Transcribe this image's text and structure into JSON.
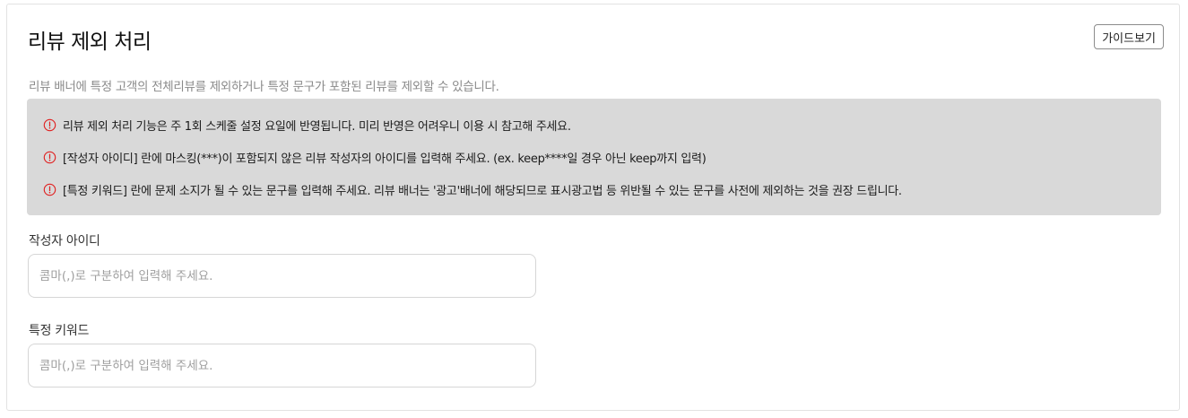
{
  "header": {
    "title": "리뷰 제외 처리",
    "guide_button": "가이드보기"
  },
  "description": "리뷰 배너에 특정 고객의 전체리뷰를 제외하거나 특정 문구가 포함된 리뷰를 제외할 수 있습니다.",
  "notices": [
    "리뷰 제외 처리 기능은 주 1회 스케줄 설정 요일에 반영됩니다. 미리 반영은 어려우니 이용 시 참고해 주세요.",
    "[작성자 아이디] 란에 마스킹(***)이 포함되지 않은 리뷰 작성자의 아이디를 입력해 주세요. (ex. keep****일 경우 아닌 keep까지 입력)",
    "[특정 키워드] 란에 문제 소지가 될 수 있는 문구를 입력해 주세요. 리뷰 배너는 '광고'배너에 해당되므로 표시광고법 등 위반될 수 있는 문구를 사전에 제외하는 것을 권장 드립니다."
  ],
  "fields": {
    "author_id": {
      "label": "작성자 아이디",
      "value": "",
      "placeholder": "콤마(,)로 구분하여 입력해 주세요."
    },
    "keyword": {
      "label": "특정 키워드",
      "value": "",
      "placeholder": "콤마(,)로 구분하여 입력해 주세요."
    }
  },
  "colors": {
    "warning_icon": "#e02020",
    "notice_background": "#d9d9d9",
    "description_text": "#8a8a8a"
  },
  "icons": {
    "notice": "exclamation-circle-icon"
  }
}
